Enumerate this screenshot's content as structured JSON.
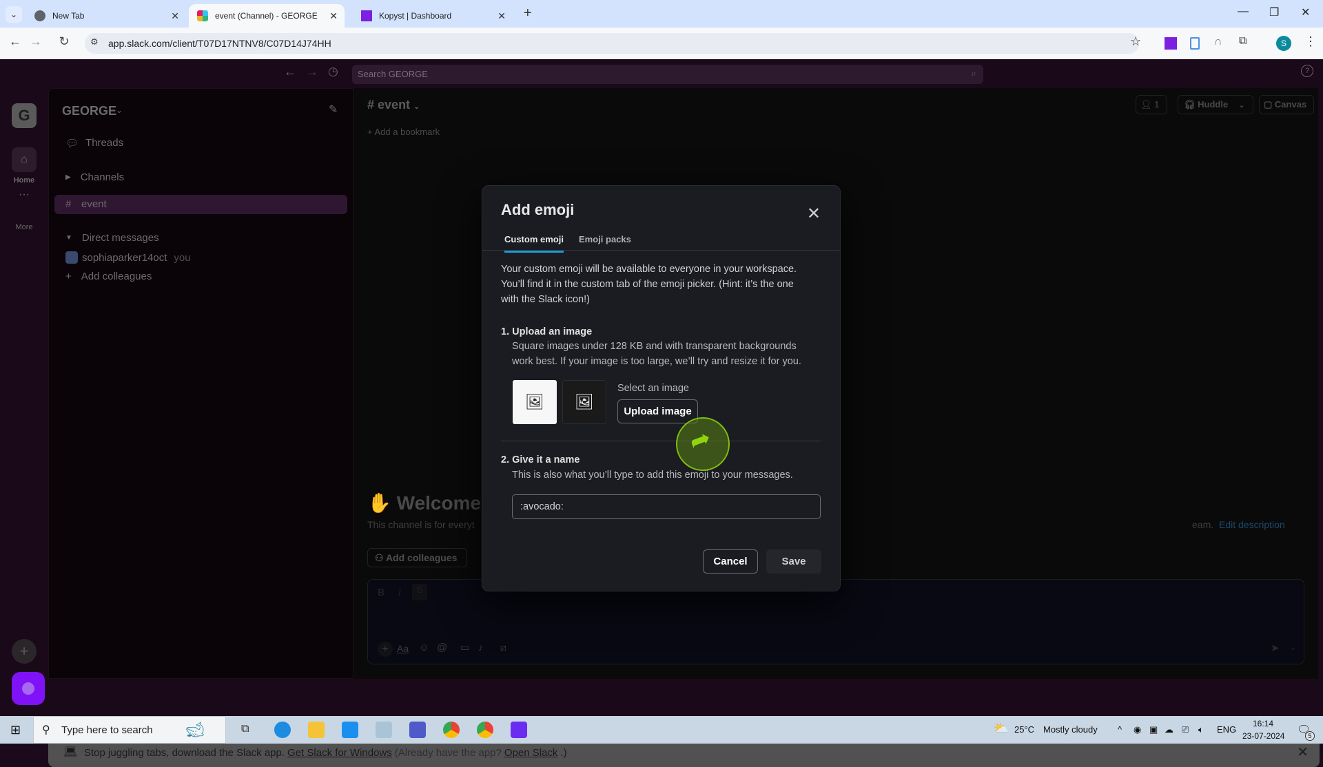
{
  "browser": {
    "tabs": [
      {
        "title": "New Tab",
        "icon": "chrome-icon",
        "active": false
      },
      {
        "title": "event (Channel) - GEORGE - Sla",
        "icon": "slack-icon",
        "active": true
      },
      {
        "title": "Kopyst | Dashboard",
        "icon": "kopyst-icon",
        "active": false
      }
    ],
    "new_tab_label": "+",
    "url": "app.slack.com/client/T07D17NTNV8/C07D14J74HH",
    "profile_initial": "S"
  },
  "slack": {
    "search_placeholder": "Search GEORGE",
    "workspace_initial": "G",
    "workspace_name": "GEORGE",
    "rail": {
      "home_label": "Home",
      "more_label": "More"
    },
    "sidebar": {
      "threads_label": "Threads",
      "channels_label": "Channels",
      "active_channel": "event",
      "dm_label": "Direct messages",
      "dm_user": "sophiaparker14oct",
      "dm_you": "you",
      "add_colleagues": "Add colleagues"
    },
    "channel": {
      "name": "event",
      "members_count": "1",
      "huddle_label": "Huddle",
      "canvas_label": "Canvas",
      "bookmark_label": "Add a bookmark",
      "welcome_title": "Welcome",
      "description_start": "This channel is for everyt",
      "description_end": "eam.",
      "edit_description": "Edit description",
      "add_colleagues_btn": "Add colleagues"
    },
    "banner": {
      "text": "Stop juggling tabs, download the Slack app.",
      "link1": "Get Slack for Windows",
      "middle": "(Already have the app?",
      "link2": "Open Slack",
      "end": ".)"
    }
  },
  "modal": {
    "title": "Add emoji",
    "tabs": [
      {
        "label": "Custom emoji",
        "active": true
      },
      {
        "label": "Emoji packs",
        "active": false
      }
    ],
    "intro_line1": "Your custom emoji will be available to everyone in your workspace.",
    "intro_line2": "You’ll find it in the custom tab of the emoji picker. (Hint: it’s the one",
    "intro_line3": "with the Slack icon!)",
    "step1_heading": "1. Upload an image",
    "step1_line1": "Square images under 128 KB and with transparent backgrounds",
    "step1_line2": "work best. If your image is too large, we’ll try and resize it for you.",
    "select_label": "Select an image",
    "upload_button": "Upload image",
    "step2_heading": "2. Give it a name",
    "step2_sub": "This is also what you’ll type to add this emoji to your messages.",
    "name_value": ":avocado:",
    "cancel_button": "Cancel",
    "save_button": "Save"
  },
  "taskbar": {
    "search_placeholder": "Type here to search",
    "weather_temp": "25°C",
    "weather_text": "Mostly cloudy",
    "language": "ENG",
    "time": "16:14",
    "date": "23-07-2024",
    "notification_count": "5"
  }
}
